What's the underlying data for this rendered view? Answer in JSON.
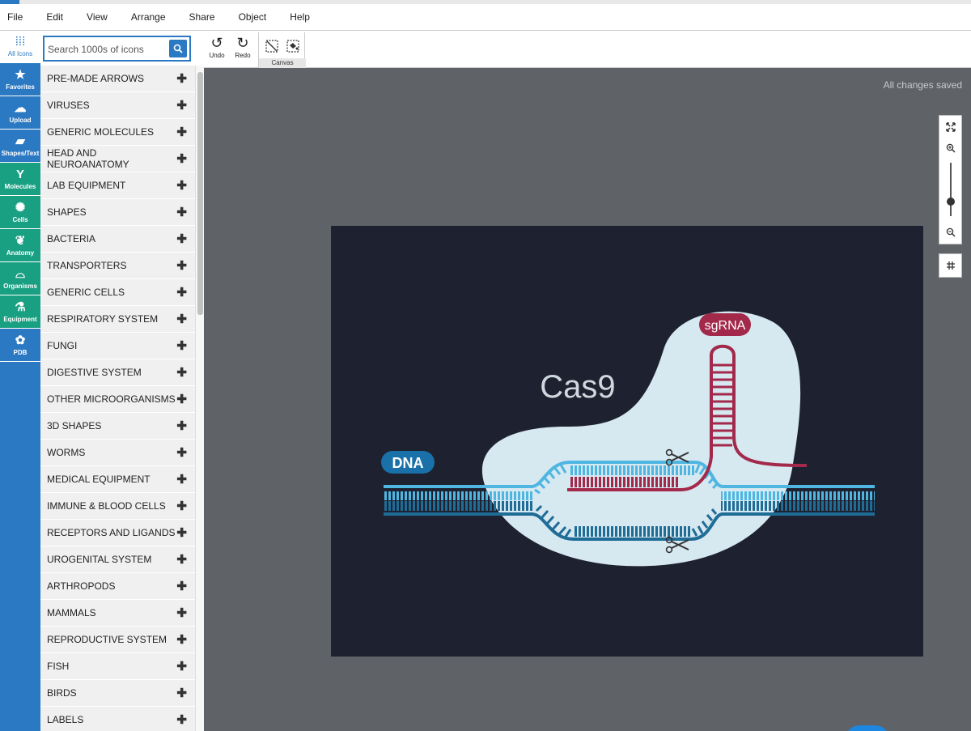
{
  "menu": [
    "File",
    "Edit",
    "View",
    "Arrange",
    "Share",
    "Object",
    "Help"
  ],
  "rail": [
    {
      "label": "All Icons",
      "icon": "grid-dots-icon"
    },
    {
      "label": "Favorites",
      "icon": "star-icon"
    },
    {
      "label": "Upload",
      "icon": "cloud-upload-icon"
    },
    {
      "label": "Shapes/Text",
      "icon": "shapes-text-icon"
    },
    {
      "label": "Molecules",
      "icon": "antibody-icon"
    },
    {
      "label": "Cells",
      "icon": "cell-icon"
    },
    {
      "label": "Anatomy",
      "icon": "kidney-icon"
    },
    {
      "label": "Organisms",
      "icon": "mouse-icon"
    },
    {
      "label": "Equipment",
      "icon": "microscope-icon"
    },
    {
      "label": "PDB",
      "icon": "protein-icon"
    }
  ],
  "search": {
    "placeholder": "Search 1000s of icons"
  },
  "categories": [
    "PRE-MADE ARROWS",
    "VIRUSES",
    "GENERIC MOLECULES",
    "HEAD AND NEUROANATOMY",
    "LAB EQUIPMENT",
    "SHAPES",
    "BACTERIA",
    "TRANSPORTERS",
    "GENERIC CELLS",
    "RESPIRATORY SYSTEM",
    "FUNGI",
    "DIGESTIVE SYSTEM",
    "OTHER MICROORGANISMS",
    "3D SHAPES",
    "WORMS",
    "MEDICAL EQUIPMENT",
    "IMMUNE & BLOOD CELLS",
    "RECEPTORS AND LIGANDS",
    "UROGENITAL SYSTEM",
    "ARTHROPODS",
    "MAMMALS",
    "REPRODUCTIVE SYSTEM",
    "FISH",
    "BIRDS",
    "LABELS"
  ],
  "toolbar": {
    "undo": "Undo",
    "redo": "Redo",
    "canvas": "Canvas"
  },
  "status": {
    "saved": "All changes saved"
  },
  "figure": {
    "protein_label": "Cas9",
    "guide_label": "sgRNA",
    "dna_label": "DNA"
  },
  "colors": {
    "brand_blue": "#2b79c2",
    "category_green": "#19a082",
    "workspace_gray": "#5f6266",
    "artboard_navy": "#1e2130",
    "cas9_fill": "#d6e8f0",
    "dna_light": "#4fb6e2",
    "dna_dark": "#1f6c97",
    "rna_red": "#a3294b"
  }
}
